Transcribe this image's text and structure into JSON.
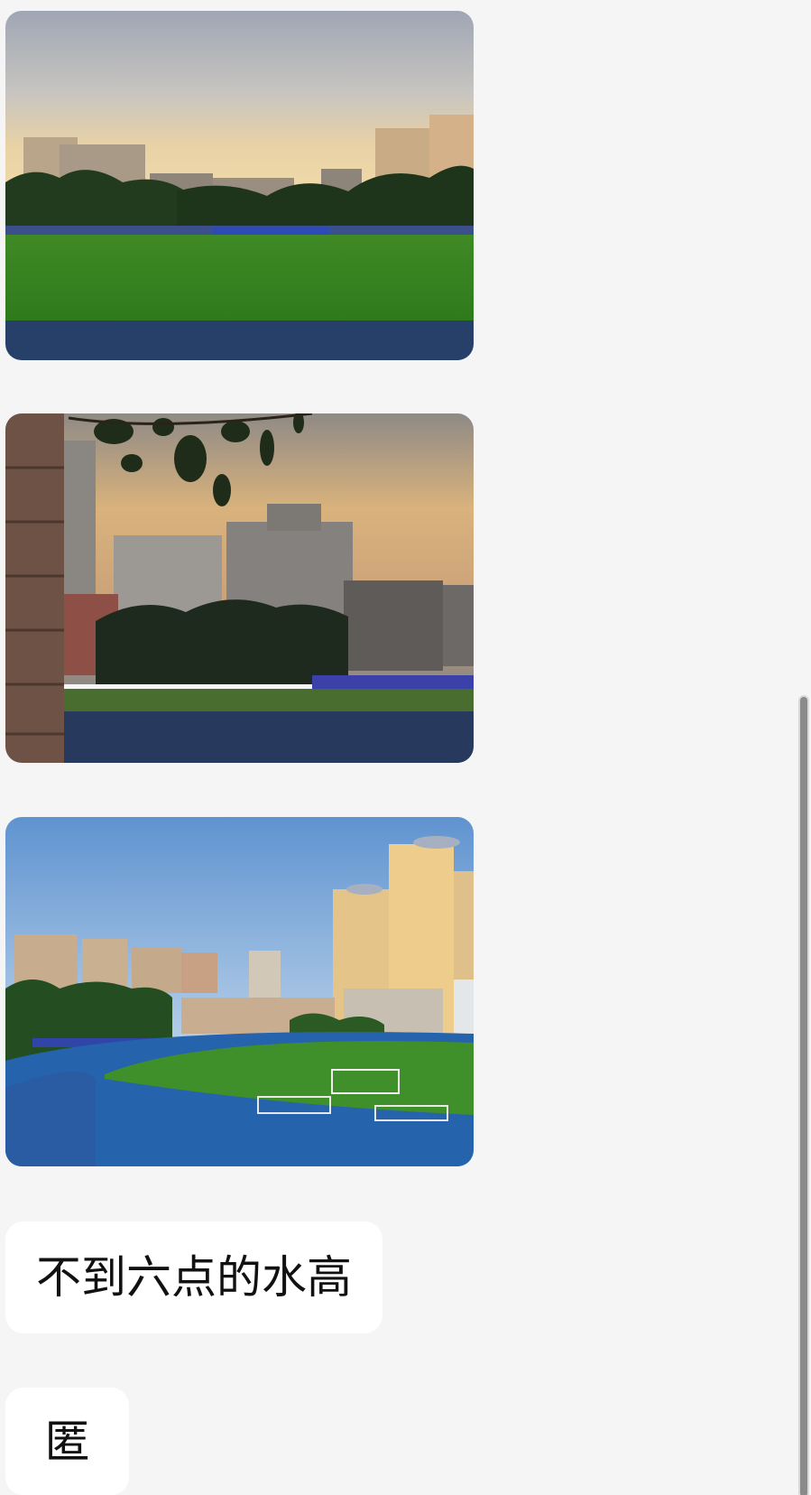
{
  "messages": [
    {
      "type": "image",
      "description_icon": "photo-field-dusk"
    },
    {
      "type": "image",
      "description_icon": "photo-sunset-buildings"
    },
    {
      "type": "image",
      "description_icon": "photo-stadium-daytime"
    },
    {
      "type": "text",
      "text": "不到六点的水高"
    },
    {
      "type": "text",
      "text": "匿"
    }
  ],
  "colors": {
    "background": "#f5f5f5",
    "bubble": "#ffffff",
    "text": "#111111",
    "scrollbar": "#8a8a8a"
  }
}
